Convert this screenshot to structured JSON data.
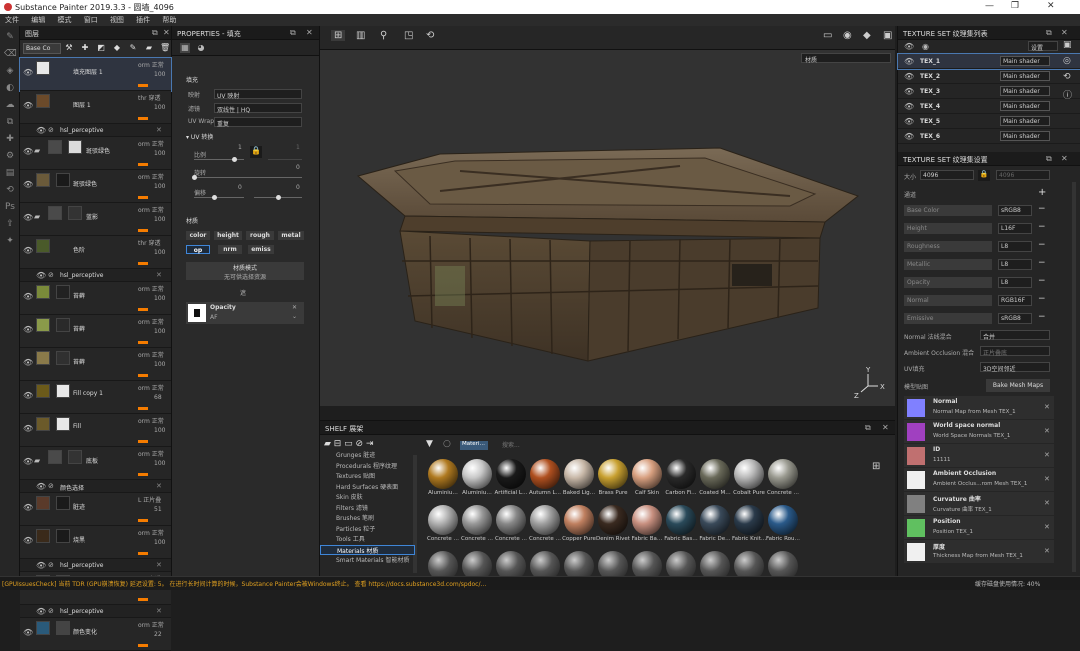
{
  "window": {
    "title": "Substance Painter 2019.3.3 - 圆墙_4096"
  },
  "menu": [
    "文件",
    "编辑",
    "模式",
    "窗口",
    "视图",
    "插件",
    "帮助"
  ],
  "layers": {
    "title": "图层",
    "blend_select": "Base Co",
    "items": [
      {
        "name": "填充图层 1",
        "blend": "orm 正常",
        "opacity": "100",
        "t1": "#e8e8e8",
        "t2": null,
        "selected": true,
        "kind": "layer"
      },
      {
        "name": "图层 1",
        "blend": "thr 穿透",
        "opacity": "100",
        "t1": "#6b4a2a",
        "t2": null,
        "kind": "layer"
      },
      {
        "name": "hsl_perceptive",
        "kind": "sub"
      },
      {
        "name": "斑驳绿色",
        "blend": "orm 正常",
        "opacity": "100",
        "t1": "#4a4a4a",
        "t2": "#dcdcdc",
        "kind": "folder"
      },
      {
        "name": "斑驳绿色",
        "blend": "orm 正常",
        "opacity": "100",
        "t1": "#6a5a3a",
        "t2": "#1a1a1a",
        "kind": "layer"
      },
      {
        "name": "蓝影",
        "blend": "orm 正常",
        "opacity": "100",
        "t1": "#4a4a4a",
        "t2": "#333333",
        "kind": "folder"
      },
      {
        "name": "色阶",
        "blend": "thr 穿透",
        "opacity": "100",
        "t1": "#4a5a2a",
        "t2": null,
        "kind": "layer"
      },
      {
        "name": "hsl_perceptive",
        "kind": "sub"
      },
      {
        "name": "苔藓",
        "blend": "orm 正常",
        "opacity": "100",
        "t1": "#7a8a3a",
        "t2": "#222222",
        "kind": "layer"
      },
      {
        "name": "苔藓",
        "blend": "orm 正常",
        "opacity": "100",
        "t1": "#8a9a4a",
        "t2": "#2a2a2a",
        "kind": "layer"
      },
      {
        "name": "苔藓",
        "blend": "orm 正常",
        "opacity": "100",
        "t1": "#8a7a4a",
        "t2": "#303030",
        "kind": "layer"
      },
      {
        "name": "Fill copy 1",
        "blend": "orm 正常",
        "opacity": "68",
        "t1": "#6b5a1a",
        "t2": "#e8e8e8",
        "kind": "layer"
      },
      {
        "name": "Fill",
        "blend": "orm 正常",
        "opacity": "100",
        "t1": "#6b5a2a",
        "t2": "#e8e8e8",
        "kind": "layer"
      },
      {
        "name": "底板",
        "blend": "orm 正常",
        "opacity": "100",
        "t1": "#4a4a4a",
        "t2": "#333333",
        "kind": "folder"
      },
      {
        "name": "颜色选择",
        "kind": "sub"
      },
      {
        "name": "脏迹",
        "blend": "L 正片叠",
        "opacity": "51",
        "t1": "#5a3a2a",
        "t2": "#1a1a1a",
        "kind": "layer"
      },
      {
        "name": "烧黑",
        "blend": "orm 正常",
        "opacity": "100",
        "t1": "#3a2a1a",
        "t2": "#1a1a1a",
        "kind": "layer"
      },
      {
        "name": "hsl_perceptive",
        "kind": "sub"
      },
      {
        "name": "斑驳绿褐",
        "blend": "thr 穿透",
        "opacity": "100",
        "t1": "#5a3a2a",
        "t2": "#888888",
        "kind": "layer"
      },
      {
        "name": "hsl_perceptive",
        "kind": "sub"
      },
      {
        "name": "颜色变化",
        "blend": "orm 正常",
        "opacity": "22",
        "t1": "#2a5a7a",
        "t2": "#444444",
        "kind": "layer"
      }
    ]
  },
  "properties": {
    "title": "PROPERTIES - 填充",
    "fill_section": "填充",
    "projection_label": "映射",
    "projection_value": "UV 映射",
    "filter_label": "滤镜",
    "filter_value": "双线性 | HQ",
    "uvwrap_label": "UV Wrap",
    "uvwrap_value": "重复",
    "uv_transform": "UV 转换",
    "scale_label": "比例",
    "scale_value": "1",
    "scale_value2": "1",
    "rotation_label": "旋转",
    "rotation_value": "0",
    "offset_label": "偏移",
    "offset_value": "0",
    "offset_value2": "0",
    "material_section": "材质",
    "channels": [
      "color",
      "height",
      "rough",
      "metal",
      "op",
      "nrm",
      "emiss"
    ],
    "material_mode": "材质模式",
    "material_mode_sub": "无可供选择资源",
    "mask_section": "遮",
    "opacity_label": "Opacity",
    "opacity_value": "uniform color",
    "opacity_sub": "AF"
  },
  "viewport": {
    "mode_select": "材质"
  },
  "shelf": {
    "title": "SHELF 展架",
    "filter_tag": "Materi…",
    "search_placeholder": "搜索...",
    "categories": [
      "Grunges 脏迹",
      "Procedurals 程序纹理",
      "Textures 贴图",
      "Hard Surfaces 硬表面",
      "Skin 皮肤",
      "Filters 滤镜",
      "Brushes 笔刷",
      "Particles 粒子",
      "Tools 工具",
      "Materials 材质",
      "Smart Materials 智能材质"
    ],
    "active_category": 9,
    "materials": [
      {
        "label": "Aluminiu…",
        "color": "#b07a20"
      },
      {
        "label": "Aluminiu…",
        "color": "#c8c8c8"
      },
      {
        "label": "Artificial L…",
        "color": "#1a1a1a"
      },
      {
        "label": "Autumn L…",
        "color": "#b05020"
      },
      {
        "label": "Baked Lig…",
        "color": "#c8b8a8"
      },
      {
        "label": "Brass Pure",
        "color": "#c8a030"
      },
      {
        "label": "Calf Skin",
        "color": "#d8a080"
      },
      {
        "label": "Carbon Fi…",
        "color": "#2a2a2a"
      },
      {
        "label": "Coated M…",
        "color": "#6a6a5a"
      },
      {
        "label": "Cobalt Pure",
        "color": "#b8b8b8"
      },
      {
        "label": "Concrete …",
        "color": "#9a9a90"
      },
      {
        "label": "Concrete …",
        "color": "#b0b0b0"
      },
      {
        "label": "Concrete …",
        "color": "#989898"
      },
      {
        "label": "Concrete …",
        "color": "#888888"
      },
      {
        "label": "Concrete …",
        "color": "#a0a0a0"
      },
      {
        "label": "Copper Pure",
        "color": "#c08060"
      },
      {
        "label": "Denim Rivet",
        "color": "#3a2a20"
      },
      {
        "label": "Fabric Ba…",
        "color": "#c89080"
      },
      {
        "label": "Fabric Bas…",
        "color": "#2a4a5a"
      },
      {
        "label": "Fabric De…",
        "color": "#3a4a5a"
      },
      {
        "label": "Fabric Knit…",
        "color": "#2a3a4a"
      },
      {
        "label": "Fabric Rou…",
        "color": "#2a5a8a"
      }
    ]
  },
  "texture_list": {
    "title": "TEXTURE SET 纹理集列表",
    "settings": "设置",
    "items": [
      {
        "name": "TEX_1",
        "shader": "Main shader",
        "selected": true
      },
      {
        "name": "TEX_2",
        "shader": "Main shader"
      },
      {
        "name": "TEX_3",
        "shader": "Main shader"
      },
      {
        "name": "TEX_4",
        "shader": "Main shader"
      },
      {
        "name": "TEX_5",
        "shader": "Main shader"
      },
      {
        "name": "TEX_6",
        "shader": "Main shader"
      }
    ]
  },
  "texture_settings": {
    "title": "TEXTURE SET 纹理集设置",
    "size_label": "大小",
    "size_value": "4096",
    "size_readonly": "4096",
    "channels_label": "通道",
    "channels": [
      {
        "name": "Base Color",
        "format": "sRGB8"
      },
      {
        "name": "Height",
        "format": "L16F"
      },
      {
        "name": "Roughness",
        "format": "L8"
      },
      {
        "name": "Metallic",
        "format": "L8"
      },
      {
        "name": "Opacity",
        "format": "L8"
      },
      {
        "name": "Normal",
        "format": "RGB16F"
      },
      {
        "name": "Emissive",
        "format": "sRGB8"
      }
    ],
    "normal_mix_label": "Normal 法线混合",
    "normal_mix_value": "合并",
    "ao_mix_label": "Ambient Occlusion 混合",
    "ao_mix_value": "正片叠底",
    "uv_fill_label": "UV填充",
    "uv_fill_value": "3D空间邻近",
    "model_maps_label": "模型贴图",
    "bake_button": "Bake Mesh Maps",
    "maps": [
      {
        "title": "Normal",
        "sub": "Normal Map from Mesh TEX_1",
        "color": "#8080ff"
      },
      {
        "title": "World space normal",
        "sub": "World Space Normals TEX_1",
        "color": "#a040c0"
      },
      {
        "title": "ID",
        "sub": "11111",
        "color": "#c07070"
      },
      {
        "title": "Ambient Occlusion",
        "sub": "Ambient Occlus…rom Mesh TEX_1",
        "color": "#f0f0f0"
      },
      {
        "title": "Curvature 曲率",
        "sub": "Curvature 曲率 TEX_1",
        "color": "#808080"
      },
      {
        "title": "Position",
        "sub": "Position TEX_1",
        "color": "#60c060"
      },
      {
        "title": "厚度",
        "sub": "Thickness Map from Mesh TEX_1",
        "color": "#f0f0f0"
      }
    ]
  },
  "status": {
    "message": "[GPUIssuesCheck] 当前 TDR (GPU崩溃恢复) 延迟设置: 5。 在进行长时间计算的时候，Substance Painter会被Windows终止。 查看 https://docs.substance3d.com/spdoc/...",
    "cache": "缓存磁盘使用情况: 40%"
  }
}
